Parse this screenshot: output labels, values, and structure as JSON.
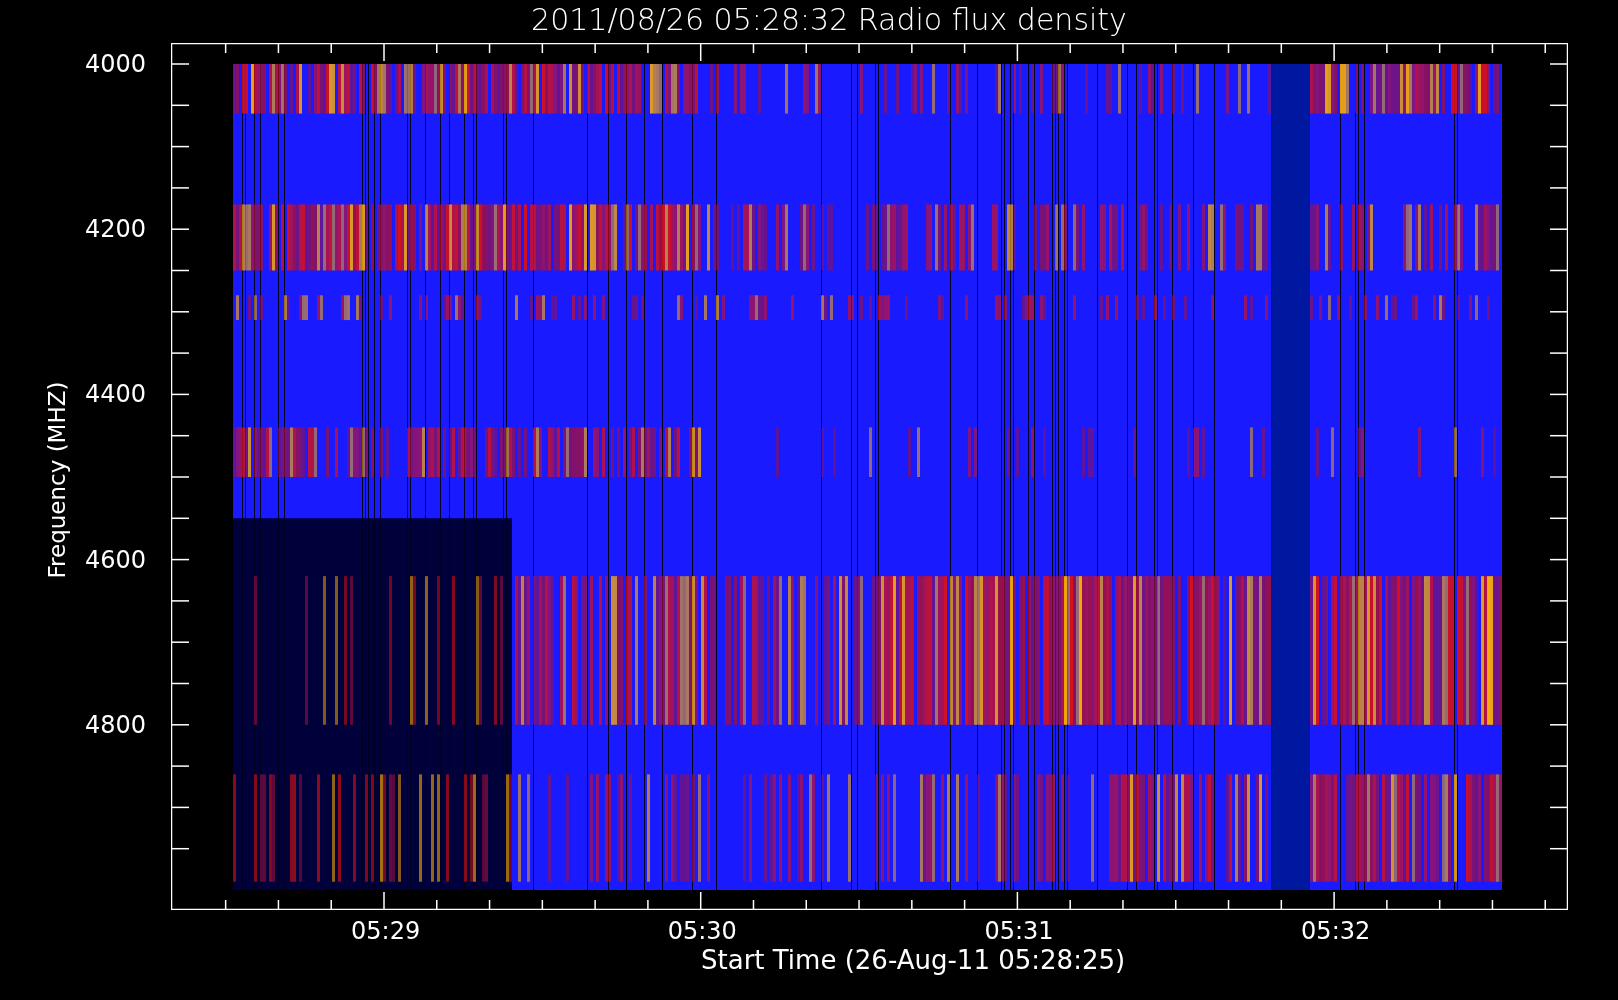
{
  "title": "2011/08/26 05:28:32 Radio flux density",
  "ylabel": "Frequency (MHZ)",
  "xlabel": "Start Time (26-Aug-11 05:28:25)",
  "yticks": [
    "4000",
    "4200",
    "4400",
    "4600",
    "4800"
  ],
  "xticks": [
    "05:29",
    "05:30",
    "05:31",
    "05:32"
  ]
}
